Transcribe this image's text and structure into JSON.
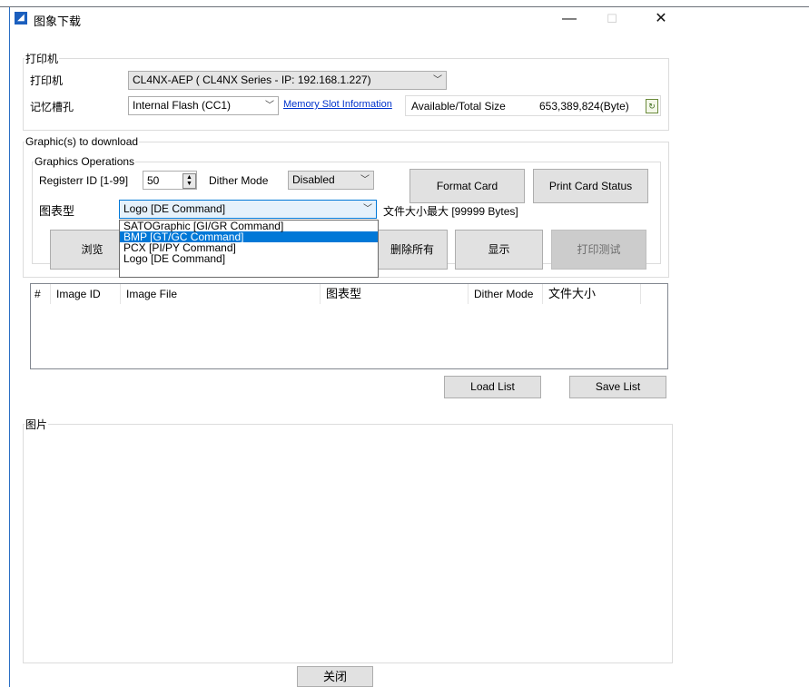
{
  "window": {
    "title": "图象下载",
    "minimize": "—",
    "maximize": "☐",
    "close": "✕"
  },
  "printer_group": {
    "legend": "打印机",
    "printer_label": "打印机",
    "printer_value": "CL4NX-AEP ( CL4NX Series - IP: 192.168.1.227)",
    "slot_label": "记忆槽孔",
    "slot_value": "Internal Flash (CC1)",
    "memory_link": "Memory Slot Information",
    "size_label": "Available/Total Size",
    "size_value": "653,389,824(Byte)"
  },
  "graphics_group": {
    "legend": "Graphic(s) to download",
    "ops_legend": "Graphics Operations",
    "register_label": "Registerr ID [1-99]",
    "register_value": "50",
    "dither_label": "Dither Mode",
    "dither_value": "Disabled",
    "format_card": "Format Card",
    "print_card_status": "Print Card Status",
    "type_label": "图表型",
    "type_value": "Logo [DE Command]",
    "max_size_note": "文件大小最大 [99999 Bytes]",
    "dropdown_options": [
      "SATOGraphic [GI/GR Command]",
      "BMP [GT/GC Command]",
      "PCX [PI/PY Command]",
      "Logo [DE Command]"
    ],
    "selected_option_index": 1,
    "browse": "浏览",
    "delete_all": "删除所有",
    "show": "显示",
    "print_test": "打印测试"
  },
  "table": {
    "columns": [
      "#",
      "Image ID",
      "Image File",
      "图表型",
      "Dither Mode",
      "文件大小"
    ],
    "rows": []
  },
  "list_buttons": {
    "load": "Load List",
    "save": "Save List"
  },
  "picture_group": {
    "legend": "图片"
  },
  "close_button": "关闭",
  "colors": {
    "accent": "#0078d7",
    "link": "#0033cc",
    "window_border": "#2a6fc4"
  }
}
